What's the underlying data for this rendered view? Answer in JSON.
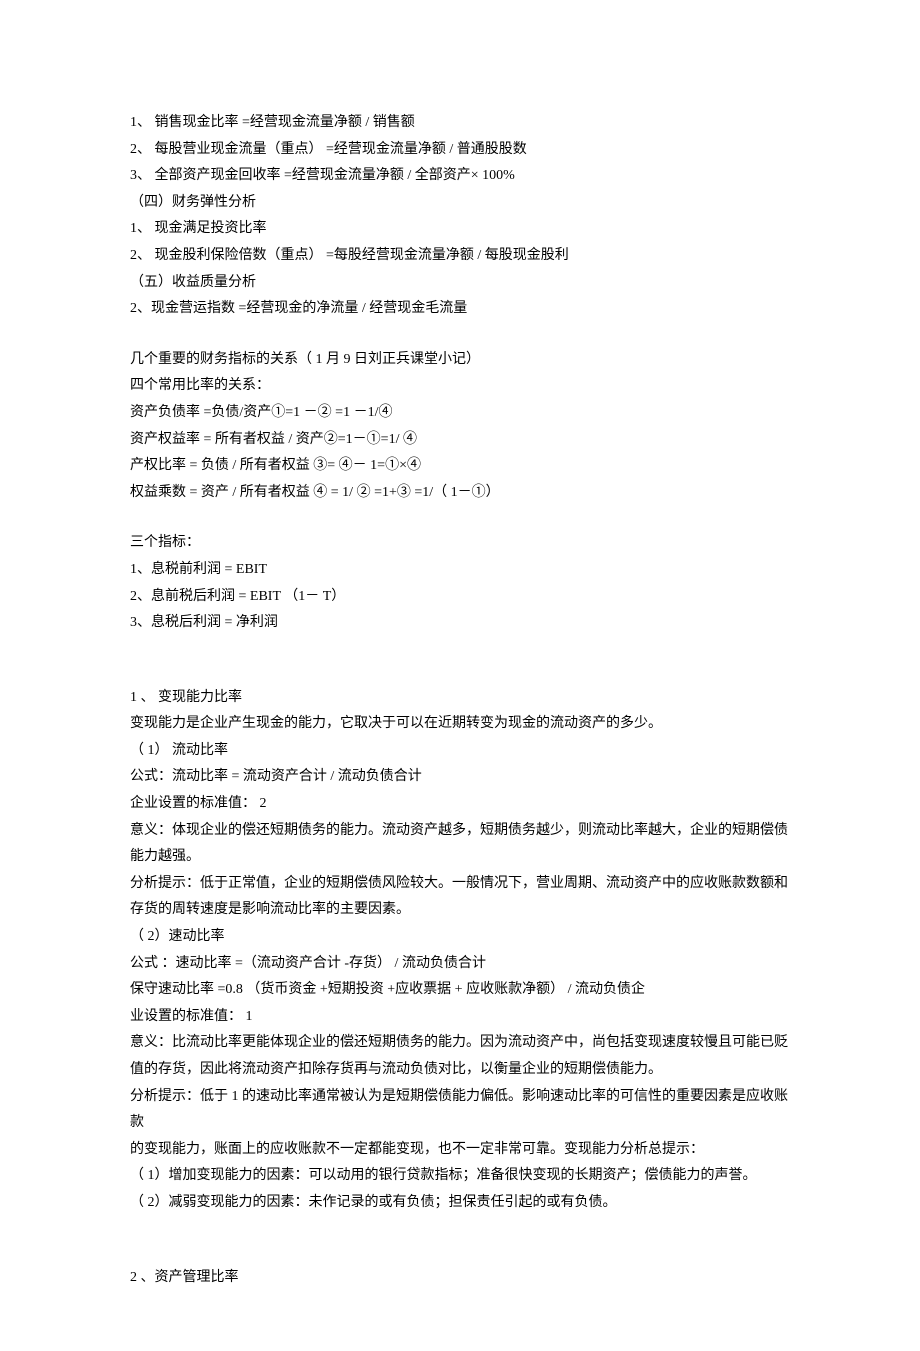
{
  "l1": "1、 销售现金比率  =经营现金流量净额    / 销售额",
  "l2": "2、 每股营业现金流量（重点）     =经营现金流量净额  / 普通股股数",
  "l3": "3、 全部资产现金回收率   =经营现金流量净额  / 全部资产× 100%",
  "l4": "（四）财务弹性分析",
  "l5": "1、 现金满足投资比率",
  "l6": "2、 现金股利保险倍数（重点）     =每股经营现金流量净额    / 每股现金股利",
  "l7": "（五）收益质量分析",
  "l8": "2、现金营运指数   =经营现金的净流量  / 经营现金毛流量",
  "l9": "几个重要的财务指标的关系（     1 月 9 日刘正兵课堂小记）",
  "l10": "四个常用比率的关系：",
  "l11": "资产负债率  =负债/资产①=1  －②  =1 －1/④",
  "l12": "资产权益率  = 所有者权益  /    资产②=1－①=1/ ④",
  "l13": "产权比率  =   负债 /   所有者权益   ③= ④－  1=①×④",
  "l14": "权益乘数  =  资产 /   所有者权益   ④ = 1/ ② =1+③ =1/（  1－①）",
  "l15": "三个指标：",
  "l16": "1、息税前利润   = EBIT",
  "l17": "2、息前税后利润   = EBIT （1－ T）",
  "l18": "3、息税后利润   =  净利润",
  "l19": "1 、 变现能力比率",
  "l20": "变现能力是企业产生现金的能力，它取决于可以在近期转变为现金的流动资产的多少。",
  "l21": "（ 1）  流动比率",
  "l22": "公式：流动比率  = 流动资产合计   / 流动负债合计",
  "l23": "企业设置的标准值：   2",
  "l24": "意义：体现企业的偿还短期债务的能力。流动资产越多，短期债务越少，则流动比率越大，企业的短期偿债能力越强。",
  "l25": "分析提示：低于正常值，企业的短期偿债风险较大。一般情况下，营业周期、流动资产中的应收账款数额和存货的周转速度是影响流动比率的主要因素。",
  "l26": "（ 2）速动比率",
  "l27": "公式  ：速动比率  =（流动资产合计  -存货） / 流动负债合计",
  "l28": "保守速动比率 =0.8 （货币资金 +短期投资 +应收票据 + 应收账款净额）  / 流动负债企",
  "l29": "业设置的标准值：  1",
  "l30": "意义：比流动比率更能体现企业的偿还短期债务的能力。因为流动资产中，尚包括变现速度较慢且可能已贬值的存货，因此将流动资产扣除存货再与流动负债对比，以衡量企业的短期偿债能力。",
  "l31": "分析提示：低于 1 的速动比率通常被认为是短期偿债能力偏低。影响速动比率的可信性的重要因素是应收账款",
  "l32": "的变现能力，账面上的应收账款不一定都能变现，也不一定非常可靠。变现能力分析总提示：",
  "l33": "（ 1）增加变现能力的因素：可以动用的银行贷款指标；准备很快变现的长期资产；偿债能力的声誉。",
  "l34": "（ 2）减弱变现能力的因素：未作记录的或有负债；担保责任引起的或有负债。",
  "l35": "2 、资产管理比率"
}
